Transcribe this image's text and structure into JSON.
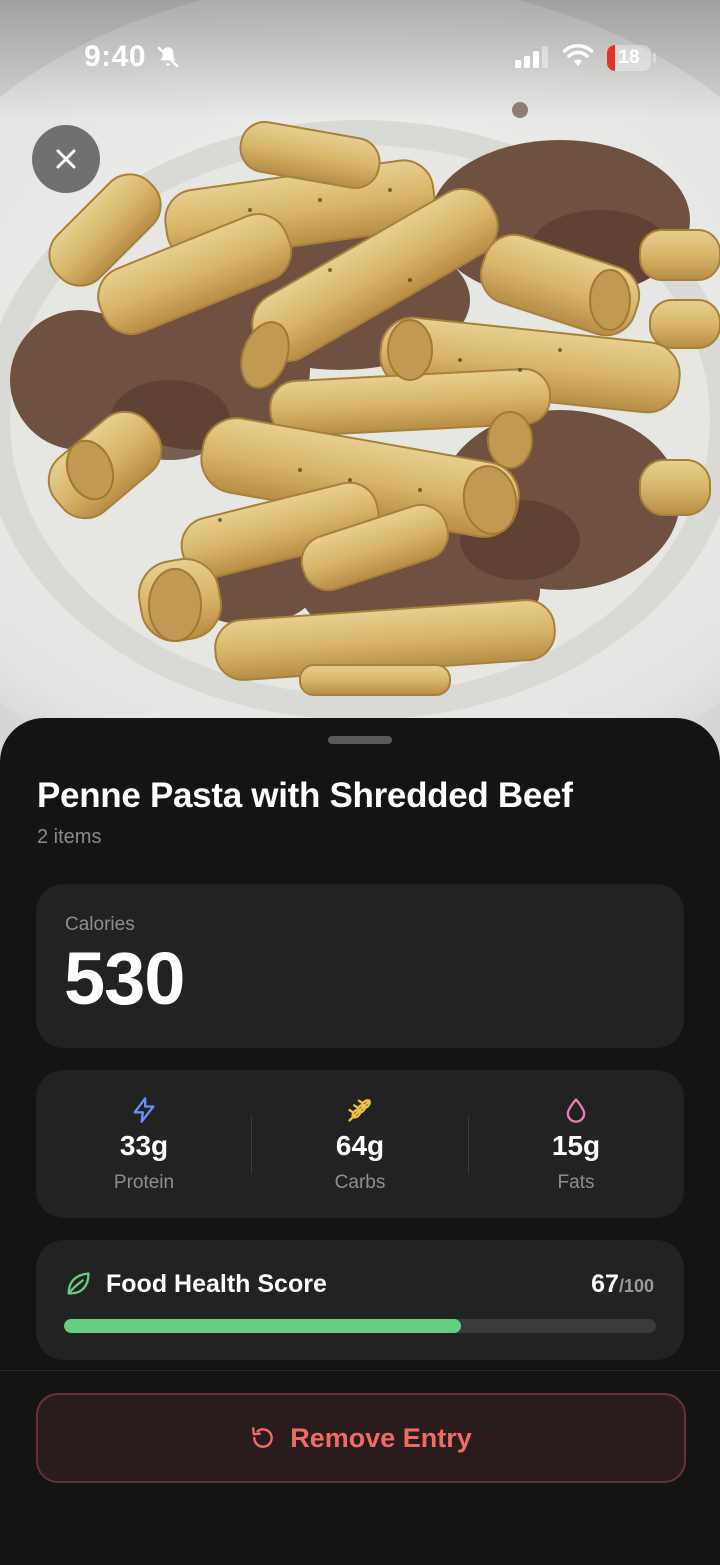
{
  "status_bar": {
    "time": "9:40",
    "battery_level": "18",
    "battery_fraction": 0.18,
    "icons": [
      "bell-slash-icon",
      "signal-icon",
      "wifi-icon",
      "battery-icon"
    ]
  },
  "photo": {
    "description_icon": "food-photo",
    "close_icon": "close-icon"
  },
  "meal": {
    "title": "Penne Pasta with Shredded Beef",
    "subtitle": "2 items"
  },
  "calories": {
    "label": "Calories",
    "value": "530"
  },
  "macros": [
    {
      "value": "33g",
      "label": "Protein",
      "icon": "lightning-icon",
      "color": "#6b8ff7"
    },
    {
      "value": "64g",
      "label": "Carbs",
      "icon": "wheat-icon",
      "color": "#f0c040"
    },
    {
      "value": "15g",
      "label": "Fats",
      "icon": "droplet-icon",
      "color": "#f07cc0"
    }
  ],
  "health_score": {
    "label": "Food Health Score",
    "value": "67",
    "max": "/100",
    "fraction": 0.67,
    "icon": "leaf-icon",
    "color": "#66cf7f"
  },
  "actions": {
    "remove_label": "Remove Entry",
    "remove_icon": "undo-icon",
    "remove_color": "#ef6b63"
  }
}
